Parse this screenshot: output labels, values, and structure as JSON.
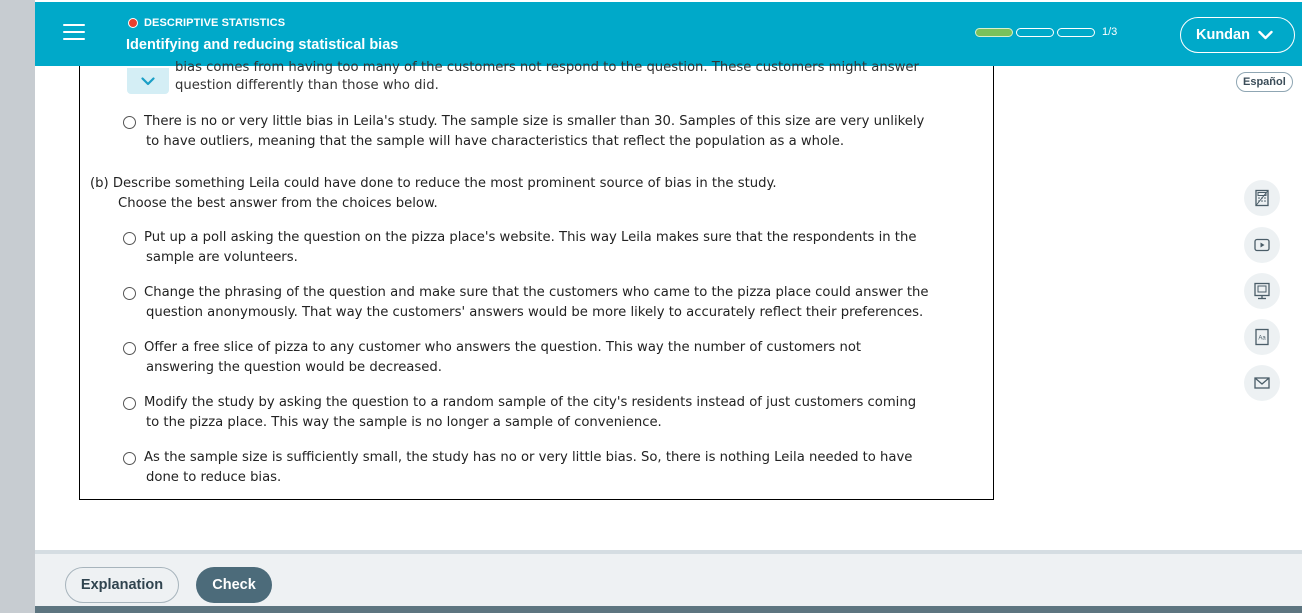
{
  "header": {
    "topic": "DESCRIPTIVE STATISTICS",
    "title": "Identifying and reducing statistical bias",
    "progress_text": "1/3",
    "progress_value": 0.33,
    "user_name": "Kundan"
  },
  "language_button": "Español",
  "question": {
    "partial_line_1": "bias comes from having too many of the customers not respond to the question. These customers might answer",
    "partial_line_2": "question differently than those who did.",
    "prev_option": {
      "line1": "There is no or very little bias in Leila's study. The sample size is smaller than 30. Samples of this size are very unlikely",
      "line2": "to have outliers, meaning that the sample will have characteristics that reflect the population as a whole."
    },
    "part_b": {
      "prompt": "(b) Describe something Leila could have done to reduce the most prominent source of bias in the study.",
      "instruction": "Choose the best answer from the choices below.",
      "options": [
        {
          "line1": "Put up a poll asking the question on the pizza place's website. This way Leila makes sure that the respondents in the",
          "line2": "sample are volunteers."
        },
        {
          "line1": "Change the phrasing of the question and make sure that the customers who came to the pizza place could answer the",
          "line2": "question anonymously. That way the customers' answers would be more likely to accurately reflect their preferences."
        },
        {
          "line1": "Offer a free slice of pizza to any customer who answers the question. This way the number of customers not",
          "line2": "answering the question would be decreased."
        },
        {
          "line1": "Modify the study by asking the question to a random sample of the city's residents instead of just customers coming",
          "line2": "to the pizza place. This way the sample is no longer a sample of convenience."
        },
        {
          "line1": "As the sample size is sufficiently small, the study has no or very little bias. So, there is nothing Leila needed to have",
          "line2": "done to reduce bias."
        }
      ]
    }
  },
  "footer": {
    "explanation_label": "Explanation",
    "check_label": "Check"
  },
  "tools": [
    "calculator-icon",
    "video-icon",
    "textbook-icon",
    "dictionary-icon",
    "mail-icon"
  ]
}
